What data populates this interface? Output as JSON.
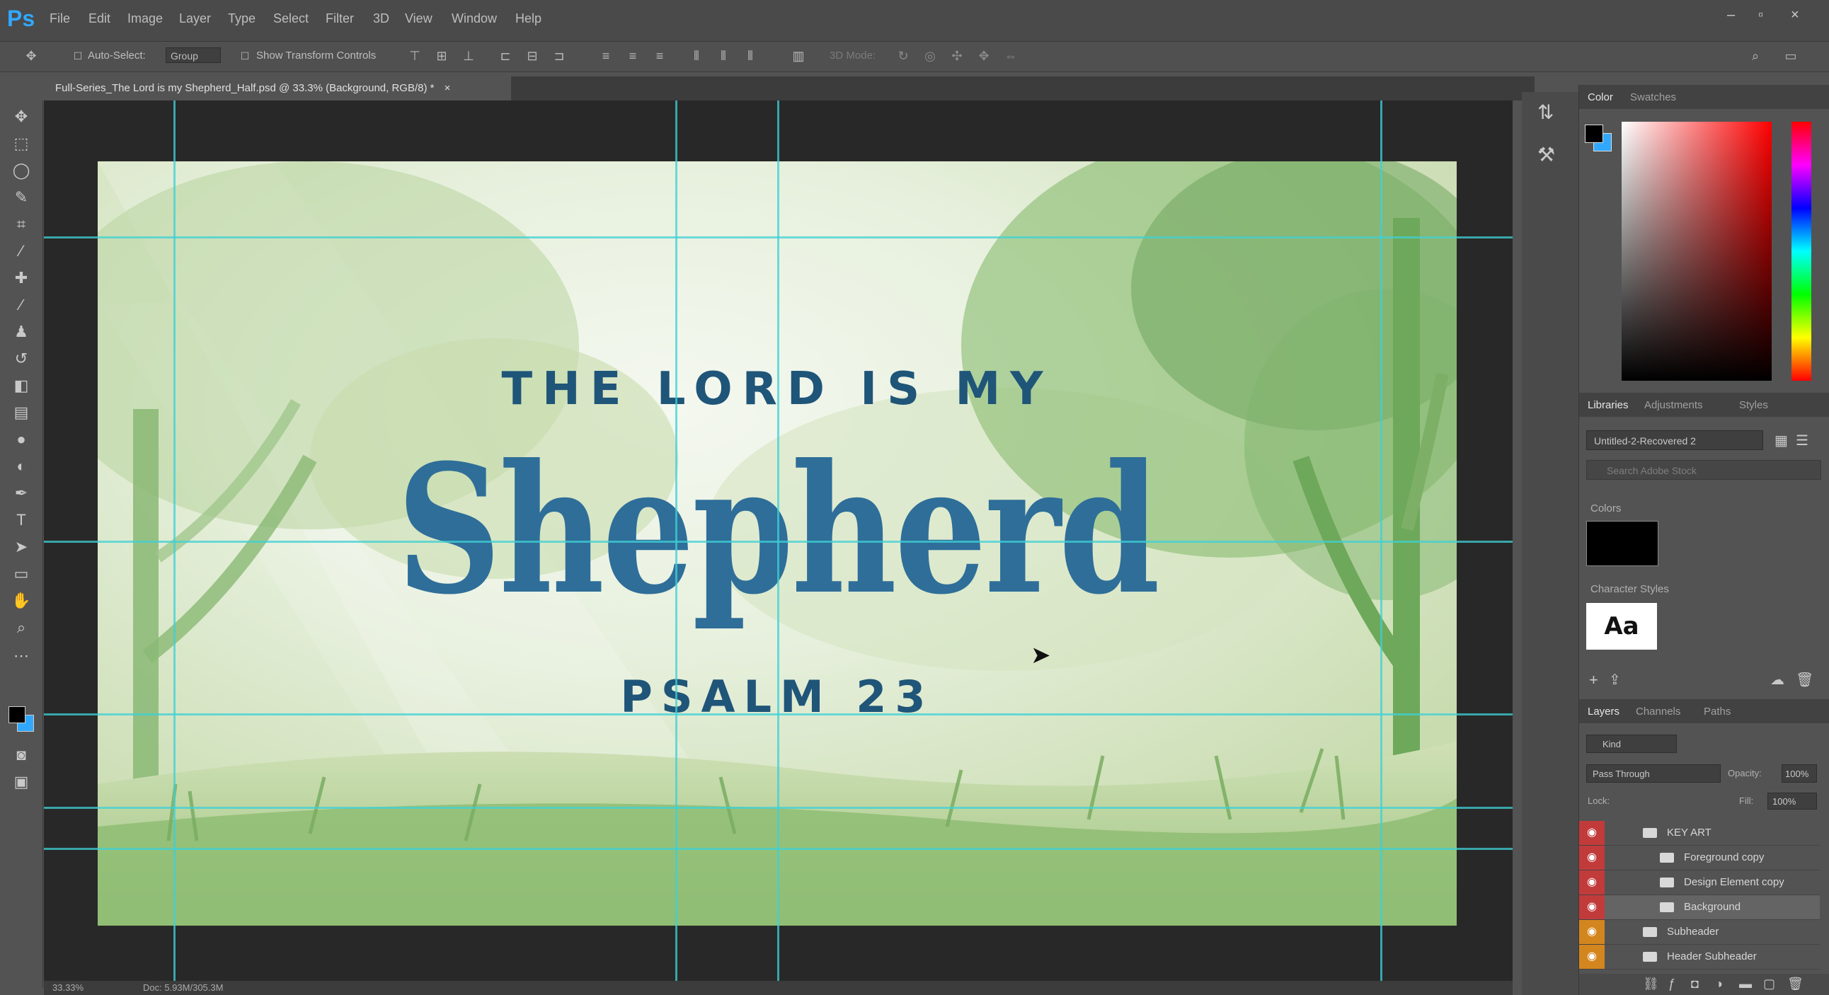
{
  "app": {
    "logo": "Ps"
  },
  "menu": [
    "File",
    "Edit",
    "Image",
    "Layer",
    "Type",
    "Select",
    "Filter",
    "3D",
    "View",
    "Window",
    "Help"
  ],
  "window_controls": {
    "minimize": "–",
    "restore": "▫",
    "close": "×"
  },
  "options_bar": {
    "auto_select_label": "Auto-Select:",
    "auto_select_value": "Group",
    "show_transform_label": "Show Transform Controls",
    "mode_label": "3D Mode:"
  },
  "document_tab": {
    "title": "Full-Series_The Lord is my Shepherd_Half.psd @ 33.3% (Background, RGB/8) *",
    "close": "×"
  },
  "artwork": {
    "line1": "THE LORD IS MY",
    "line2": "Shepherd",
    "line3": "PSALM 23"
  },
  "status": {
    "zoom": "33.33%",
    "doc": "Doc: 5.93M/305.3M"
  },
  "color_panel": {
    "tabs": [
      "Color",
      "Swatches"
    ]
  },
  "libraries_panel": {
    "tabs": [
      "Libraries",
      "Adjustments",
      "Styles"
    ],
    "library_name": "Untitled-2-Recovered 2",
    "search_placeholder": "Search Adobe Stock",
    "colors_label": "Colors",
    "char_styles_label": "Character Styles",
    "char_style_sample": "Aa"
  },
  "layers_panel": {
    "tabs": [
      "Layers",
      "Channels",
      "Paths"
    ],
    "kind_label": "Kind",
    "blend_mode": "Pass Through",
    "opacity_label": "Opacity:",
    "opacity_value": "100%",
    "lock_label": "Lock:",
    "fill_label": "Fill:",
    "fill_value": "100%",
    "layers": [
      {
        "name": "KEY ART",
        "eye_color": "#c23b3b",
        "indent": 0
      },
      {
        "name": "Foreground copy",
        "eye_color": "#c23b3b",
        "indent": 1
      },
      {
        "name": "Design Element copy",
        "eye_color": "#c23b3b",
        "indent": 1
      },
      {
        "name": "Background",
        "eye_color": "#c23b3b",
        "indent": 1
      },
      {
        "name": "Subheader",
        "eye_color": "#d4861e",
        "indent": 0
      },
      {
        "name": "Header Subheader",
        "eye_color": "#d4861e",
        "indent": 0
      }
    ]
  },
  "colors": {
    "accent": "#31a8ff",
    "title_blue": "#2e6e99",
    "subtitle_blue": "#1f5578",
    "guide": "#3fd0d6"
  }
}
